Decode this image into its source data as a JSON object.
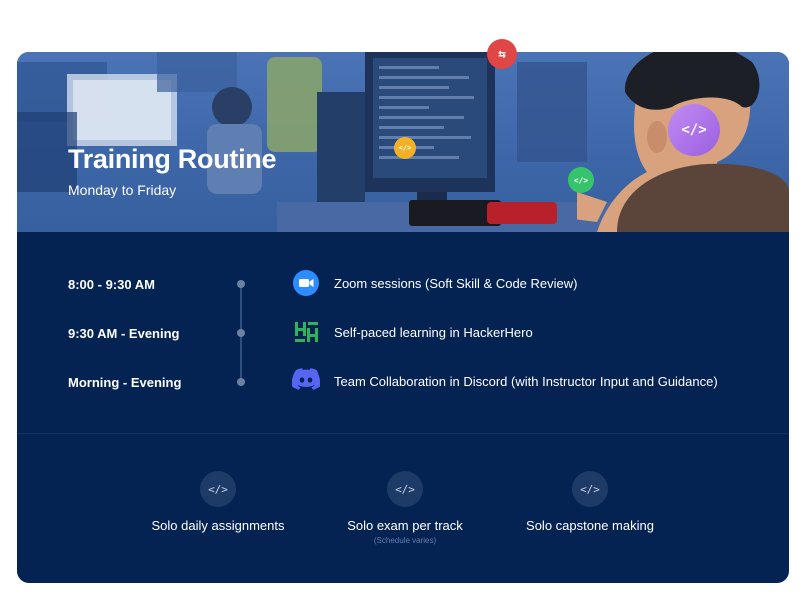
{
  "header": {
    "title": "Training Routine",
    "subtitle": "Monday to Friday"
  },
  "badges": {
    "top_red": "⇆",
    "yellow": "</>",
    "green": "</>",
    "purple": "</>"
  },
  "schedule": [
    {
      "time": "8:00 - 9:30 AM",
      "icon": "zoom-icon",
      "activity": "Zoom sessions (Soft Skill & Code Review)"
    },
    {
      "time": "9:30 AM - Evening",
      "icon": "hackerhero-icon",
      "activity": "Self-paced learning in HackerHero"
    },
    {
      "time": "Morning - Evening",
      "icon": "discord-icon",
      "activity": "Team Collaboration in Discord (with Instructor Input and Guidance)"
    }
  ],
  "tasks": [
    {
      "icon_text": "</>",
      "label": "Solo daily assignments"
    },
    {
      "icon_text": "</>",
      "label": "Solo exam per track",
      "note": "(Schedule varies)"
    },
    {
      "icon_text": "</>",
      "label": "Solo capstone making"
    }
  ],
  "colors": {
    "card_bg": "#042352",
    "hero_blue": "#4a74b6",
    "zoom_blue": "#2d8cff",
    "hackerhero_green": "#2fb35a",
    "discord_purple": "#5865f2"
  }
}
